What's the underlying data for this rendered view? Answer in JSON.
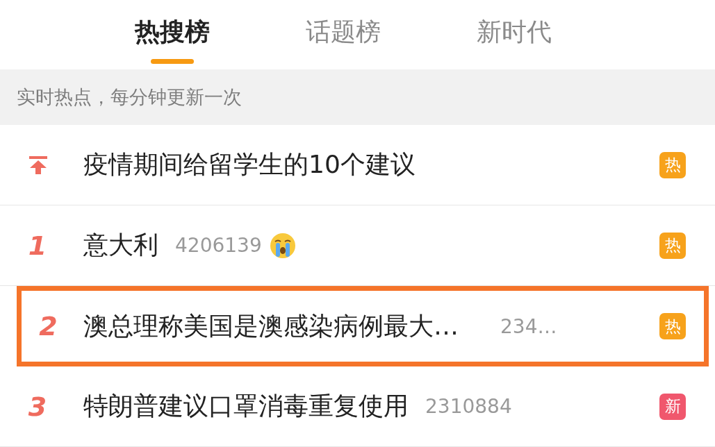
{
  "tabs": [
    {
      "label": "热搜榜",
      "selected": true
    },
    {
      "label": "话题榜",
      "selected": false
    },
    {
      "label": "新时代",
      "selected": false
    }
  ],
  "notice": "实时热点，每分钟更新一次",
  "rows": [
    {
      "kind": "pinned",
      "title": "疫情期间给留学生的10个建议",
      "badge": {
        "label": "热",
        "color": "#f7a21b"
      },
      "highlighted": false
    },
    {
      "kind": "ranked",
      "rank": "1",
      "title": "意大利",
      "count": "4206139",
      "emoji": true,
      "badge": {
        "label": "热",
        "color": "#f7a21b"
      },
      "highlighted": false
    },
    {
      "kind": "ranked",
      "rank": "2",
      "title": "澳总理称美国是澳感染病例最大…",
      "count": "234…",
      "badge": {
        "label": "热",
        "color": "#f7a21b"
      },
      "highlighted": true
    },
    {
      "kind": "ranked",
      "rank": "3",
      "title": "特朗普建议口罩消毒重复使用",
      "count": "2310884",
      "badge": {
        "label": "新",
        "color": "#f0576d"
      },
      "highlighted": false
    }
  ]
}
